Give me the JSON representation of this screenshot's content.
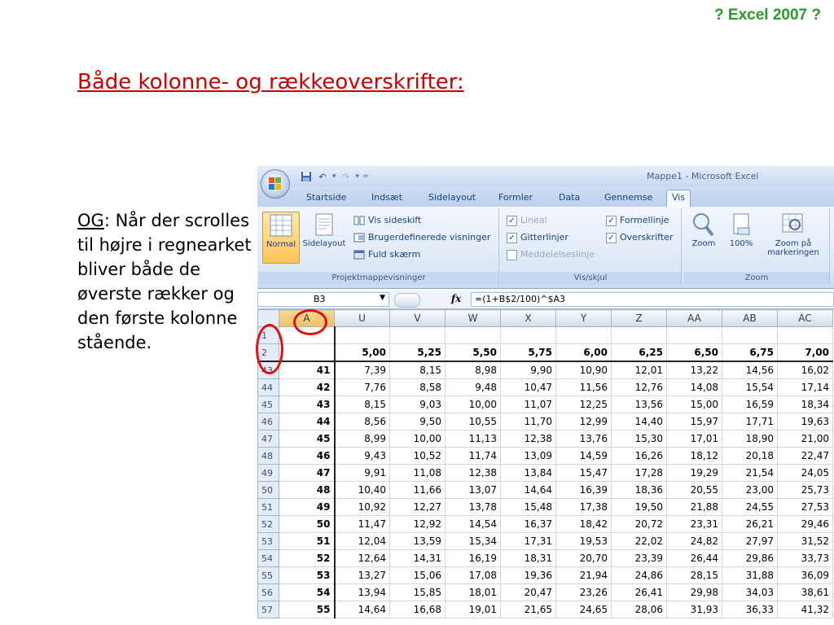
{
  "slide": {
    "corner_title": "? Excel 2007 ?",
    "heading": "Både kolonne- og rækkeoverskrifter:",
    "note_og": "OG",
    "note_rest": ": Når der scrolles til højre i regnearket bliver både de øverste rækker og den første kolonne stående."
  },
  "excel": {
    "window_title": "Mappe1 - Microsoft Excel",
    "tabs": [
      {
        "label": "Startside"
      },
      {
        "label": "Indsæt"
      },
      {
        "label": "Sidelayout"
      },
      {
        "label": "Formler"
      },
      {
        "label": "Data"
      },
      {
        "label": "Gennemse"
      },
      {
        "label": "Vis"
      }
    ],
    "active_tab": "Vis",
    "ribbon": {
      "views_group": {
        "label": "Projektmappevisninger",
        "normal": "Normal",
        "sidelayout": "Sidelayout",
        "items": [
          "Vis sideskift",
          "Brugerdefinerede visninger",
          "Fuld skærm"
        ]
      },
      "show_group": {
        "label": "Vis/skjul",
        "lineal": "Lineal",
        "gitterlinjer": "Gitterlinjer",
        "meddelelseslinje": "Meddelelseslinje",
        "formellinje": "Formellinje",
        "overskrifter": "Overskrifter"
      },
      "zoom_group": {
        "label": "Zoom",
        "zoom": "Zoom",
        "hundred": "100%",
        "zoom_sel_1": "Zoom på",
        "zoom_sel_2": "markeringen"
      }
    },
    "name_box": "B3",
    "formula": "=(1+B$2/100)^$A3",
    "fx": "fx",
    "column_headers": [
      "A",
      "U",
      "V",
      "W",
      "X",
      "Y",
      "Z",
      "AA",
      "AB",
      "AC"
    ],
    "rows": [
      {
        "num": "1",
        "a": "",
        "values": [
          "",
          "",
          "",
          "",
          "",
          "",
          "",
          "",
          ""
        ]
      },
      {
        "num": "2",
        "a": "",
        "values": [
          "5,00",
          "5,25",
          "5,50",
          "5,75",
          "6,00",
          "6,25",
          "6,50",
          "6,75",
          "7,00"
        ]
      },
      {
        "num": "43",
        "a": "41",
        "values": [
          "7,39",
          "8,15",
          "8,98",
          "9,90",
          "10,90",
          "12,01",
          "13,22",
          "14,56",
          "16,02"
        ]
      },
      {
        "num": "44",
        "a": "42",
        "values": [
          "7,76",
          "8,58",
          "9,48",
          "10,47",
          "11,56",
          "12,76",
          "14,08",
          "15,54",
          "17,14"
        ]
      },
      {
        "num": "45",
        "a": "43",
        "values": [
          "8,15",
          "9,03",
          "10,00",
          "11,07",
          "12,25",
          "13,56",
          "15,00",
          "16,59",
          "18,34"
        ]
      },
      {
        "num": "46",
        "a": "44",
        "values": [
          "8,56",
          "9,50",
          "10,55",
          "11,70",
          "12,99",
          "14,40",
          "15,97",
          "17,71",
          "19,63"
        ]
      },
      {
        "num": "47",
        "a": "45",
        "values": [
          "8,99",
          "10,00",
          "11,13",
          "12,38",
          "13,76",
          "15,30",
          "17,01",
          "18,90",
          "21,00"
        ]
      },
      {
        "num": "48",
        "a": "46",
        "values": [
          "9,43",
          "10,52",
          "11,74",
          "13,09",
          "14,59",
          "16,26",
          "18,12",
          "20,18",
          "22,47"
        ]
      },
      {
        "num": "49",
        "a": "47",
        "values": [
          "9,91",
          "11,08",
          "12,38",
          "13,84",
          "15,47",
          "17,28",
          "19,29",
          "21,54",
          "24,05"
        ]
      },
      {
        "num": "50",
        "a": "48",
        "values": [
          "10,40",
          "11,66",
          "13,07",
          "14,64",
          "16,39",
          "18,36",
          "20,55",
          "23,00",
          "25,73"
        ]
      },
      {
        "num": "51",
        "a": "49",
        "values": [
          "10,92",
          "12,27",
          "13,78",
          "15,48",
          "17,38",
          "19,50",
          "21,88",
          "24,55",
          "27,53"
        ]
      },
      {
        "num": "52",
        "a": "50",
        "values": [
          "11,47",
          "12,92",
          "14,54",
          "16,37",
          "18,42",
          "20,72",
          "23,31",
          "26,21",
          "29,46"
        ]
      },
      {
        "num": "53",
        "a": "51",
        "values": [
          "12,04",
          "13,59",
          "15,34",
          "17,31",
          "19,53",
          "22,02",
          "24,82",
          "27,97",
          "31,52"
        ]
      },
      {
        "num": "54",
        "a": "52",
        "values": [
          "12,64",
          "14,31",
          "16,19",
          "18,31",
          "20,70",
          "23,39",
          "26,44",
          "29,86",
          "33,73"
        ]
      },
      {
        "num": "55",
        "a": "53",
        "values": [
          "13,27",
          "15,06",
          "17,08",
          "19,36",
          "21,94",
          "24,86",
          "28,15",
          "31,88",
          "36,09"
        ]
      },
      {
        "num": "56",
        "a": "54",
        "values": [
          "13,94",
          "15,85",
          "18,01",
          "20,47",
          "23,26",
          "26,41",
          "29,98",
          "34,03",
          "38,61"
        ]
      },
      {
        "num": "57",
        "a": "55",
        "values": [
          "14,64",
          "16,68",
          "19,01",
          "21,65",
          "24,65",
          "28,06",
          "31,93",
          "36,33",
          "41,32"
        ]
      }
    ]
  }
}
